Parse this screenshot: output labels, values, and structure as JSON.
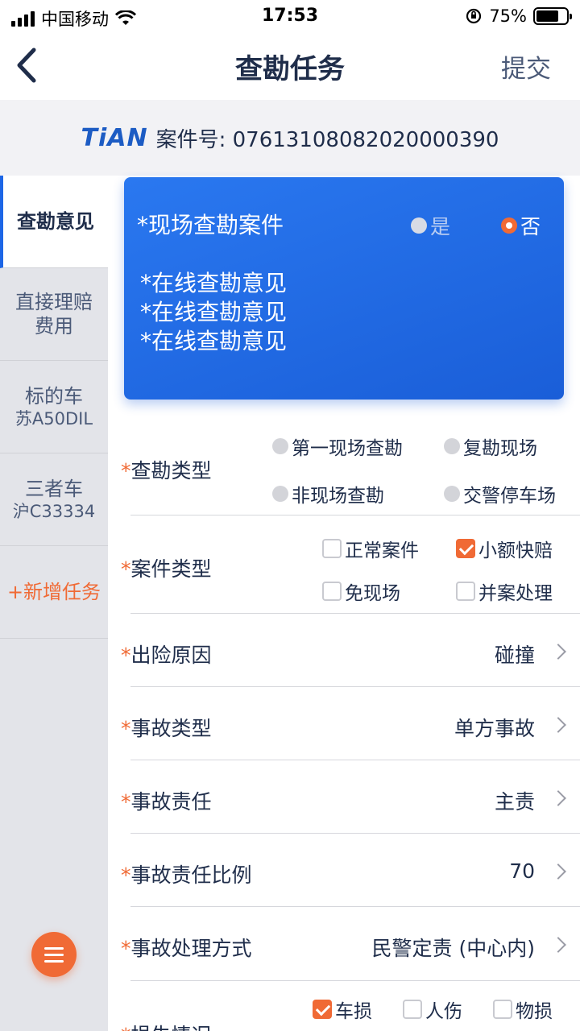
{
  "status_bar": {
    "carrier": "中国移动",
    "time": "17:53",
    "battery": "75%",
    "battery_level": 0.75
  },
  "nav": {
    "title": "查勘任务",
    "submit": "提交"
  },
  "case": {
    "logo": "TiAN",
    "label": "案件号: 07613108082020000390"
  },
  "sidebar": {
    "items": [
      {
        "title": "查勘意见",
        "sub": ""
      },
      {
        "title": "直接理赔",
        "sub": "费用"
      },
      {
        "title": "标的车",
        "sub": "苏A50DIL"
      },
      {
        "title": "三者车",
        "sub": "沪C33334"
      },
      {
        "title": "+新增任务",
        "sub": ""
      }
    ]
  },
  "card": {
    "title": "*现场查勘案件",
    "yes": "是",
    "no": "否",
    "selected": "否",
    "lines": [
      "*在线查勘意见",
      "*在线查勘意见",
      "*在线查勘意见"
    ]
  },
  "form": {
    "star": "*",
    "survey_type": {
      "label": "查勘类型",
      "options": [
        "第一现场查勘",
        "复勘现场",
        "非现场查勘",
        "交警停车场"
      ]
    },
    "case_type": {
      "label": "案件类型",
      "options": [
        {
          "text": "正常案件",
          "checked": false
        },
        {
          "text": "小额快赔",
          "checked": true
        },
        {
          "text": "免现场",
          "checked": false
        },
        {
          "text": "并案处理",
          "checked": false
        }
      ]
    },
    "rows": [
      {
        "label": "出险原因",
        "value": "碰撞"
      },
      {
        "label": "事故类型",
        "value": "单方事故"
      },
      {
        "label": "事故责任",
        "value": "主责"
      },
      {
        "label": "事故责任比例",
        "value": "70"
      },
      {
        "label": "事故处理方式",
        "value": "民警定责 (中心内)"
      }
    ],
    "loss": {
      "label": "损失情况",
      "options": [
        {
          "text": "车损",
          "checked": true
        },
        {
          "text": "人伤",
          "checked": false
        },
        {
          "text": "物损",
          "checked": false
        }
      ]
    }
  }
}
